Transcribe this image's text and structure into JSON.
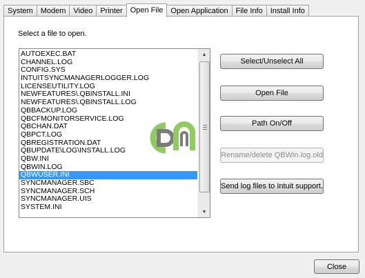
{
  "tabs": [
    {
      "label": "System",
      "active": false
    },
    {
      "label": "Modem",
      "active": false
    },
    {
      "label": "Video",
      "active": false
    },
    {
      "label": "Printer",
      "active": false
    },
    {
      "label": "Open File",
      "active": true
    },
    {
      "label": "Open Application",
      "active": false
    },
    {
      "label": "File Info",
      "active": false
    },
    {
      "label": "Install Info",
      "active": false
    }
  ],
  "open_file": {
    "prompt": "Select a file to open.",
    "files": [
      "AUTOEXEC.BAT",
      "CHANNEL.LOG",
      "CONFIG.SYS",
      "INTUITSYNCMANAGERLOGGER.LOG",
      "LICENSEUTILITY.LOG",
      "NEWFEATURES\\.QBINSTALL.INI",
      "NEWFEATURES\\.QBINSTALL.LOG",
      "QBBACKUP.LOG",
      "QBCFMONITORSERVICE.LOG",
      "QBCHAN.DAT",
      "QBPCT.LOG",
      "QBREGISTRATION.DAT",
      "QBUPDATE\\LOG\\INSTALL.LOG",
      "QBW.INI",
      "QBWIN.LOG",
      "QBWUSER.INI",
      "SYNCMANAGER.SBC",
      "SYNCMANAGER.SCH",
      "SYNCMANAGER.UIS",
      "SYSTEM.INI"
    ],
    "selected_index": 15,
    "buttons": {
      "select_all": "Select/Unselect All",
      "open_file": "Open File",
      "path_toggle": "Path On/Off",
      "rename_delete": "Rename/delete QBWin.log.old",
      "send_logs": "Send log files to Intuit support."
    }
  },
  "footer": {
    "close_label": "Close"
  },
  "colors": {
    "selection": "#3399ff",
    "watermark_green": "#7dc242",
    "watermark_gray": "#666666"
  },
  "icons": {
    "scroll_up": "▲",
    "scroll_down": "▼"
  }
}
